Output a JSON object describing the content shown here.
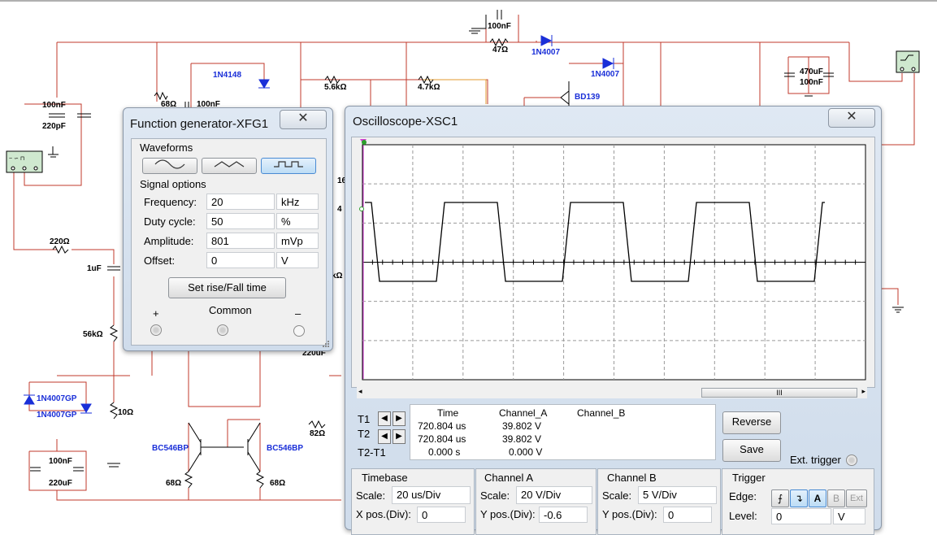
{
  "schematic": {
    "labels": {
      "c100nf_top": "100nF",
      "r47": "47Ω",
      "d_1n4007_a": "1N4007",
      "d_1n4007_b": "1N4007",
      "d_1n4148": "1N4148",
      "r68_a": "68Ω",
      "c100nf_a": "100nF",
      "r5_6k": "5.6kΩ",
      "r4_7k": "4.7kΩ",
      "q_bd139": "BD139",
      "c470uf": "470uF",
      "c100nf_b": "100nF",
      "c100nf_left": "100nF",
      "c220pf": "220pF",
      "r220": "220Ω",
      "c1uf": "1uF",
      "r56k": "56kΩ",
      "d_1n4007gp_a": "1N4007GP",
      "d_1n4007gp_b": "1N4007GP",
      "r10": "10Ω",
      "c100nf_bottom": "100nF",
      "c220uf": "220uF",
      "q_bc546_a": "BC546BP",
      "q_bc546_b": "BC546BP",
      "r68_b": "68Ω",
      "r68_c": "68Ω",
      "r82": "82Ω",
      "c220uf_b": "220uF",
      "frag_k": "kΩ",
      "frag_16": "16",
      "frag_4": "4"
    }
  },
  "function_generator": {
    "title": "Function generator-XFG1",
    "close_glyph": "✕",
    "waveforms_label": "Waveforms",
    "signal_options_label": "Signal options",
    "rows": [
      {
        "label": "Frequency:",
        "value": "20",
        "unit": "kHz"
      },
      {
        "label": "Duty cycle:",
        "value": "50",
        "unit": "%"
      },
      {
        "label": "Amplitude:",
        "value": "801",
        "unit": "mVp"
      },
      {
        "label": "Offset:",
        "value": "0",
        "unit": "V"
      }
    ],
    "rise_fall_button": "Set rise/Fall time",
    "plus_label": "+",
    "common_label": "Common",
    "minus_label": "–",
    "selected_waveform": "square"
  },
  "oscilloscope": {
    "title": "Oscilloscope-XSC1",
    "close_glyph": "✕",
    "waveform_color": "#000000",
    "screen_background": "#ffffff",
    "scrollbar_grip": "III",
    "readout": {
      "headers": [
        "Time",
        "Channel_A",
        "Channel_B"
      ],
      "rows": [
        {
          "label": "T1",
          "time": "720.804 us",
          "a": "39.802 V",
          "b": ""
        },
        {
          "label": "T2",
          "time": "720.804 us",
          "a": "39.802 V",
          "b": ""
        },
        {
          "label": "T2-T1",
          "time": "0.000 s",
          "a": "0.000 V",
          "b": ""
        }
      ]
    },
    "reverse_button": "Reverse",
    "save_button": "Save",
    "ext_trigger_label": "Ext. trigger",
    "timebase": {
      "title": "Timebase",
      "scale_label": "Scale:",
      "scale_value": "20 us/Div",
      "xpos_label": "X pos.(Div):",
      "xpos_value": "0"
    },
    "channel_a": {
      "title": "Channel A",
      "scale_label": "Scale:",
      "scale_value": "20  V/Div",
      "ypos_label": "Y pos.(Div):",
      "ypos_value": "-0.6"
    },
    "channel_b": {
      "title": "Channel B",
      "scale_label": "Scale:",
      "scale_value": "5  V/Div",
      "ypos_label": "Y pos.(Div):",
      "ypos_value": "0"
    },
    "trigger": {
      "title": "Trigger",
      "edge_label": "Edge:",
      "level_label": "Level:",
      "level_value": "0",
      "level_unit": "V",
      "source_a": "A",
      "source_b": "B",
      "source_ext": "Ext"
    }
  }
}
